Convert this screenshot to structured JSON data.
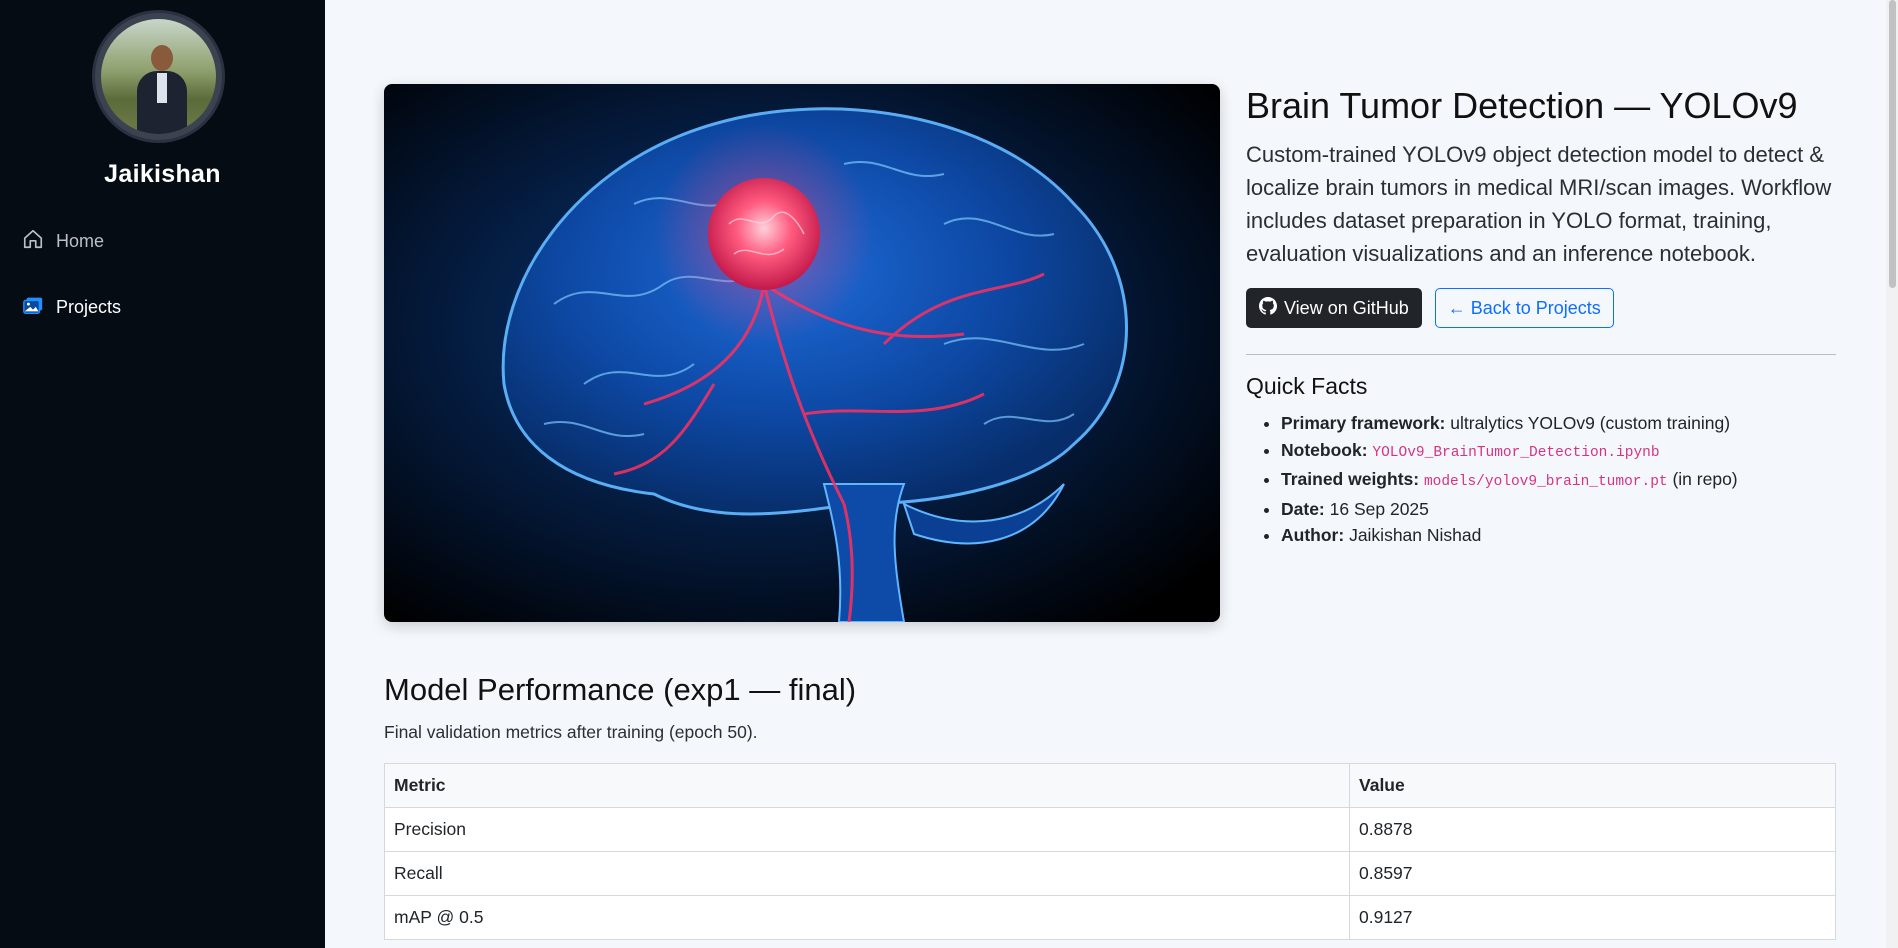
{
  "sidebar": {
    "name": "Jaikishan",
    "items": [
      {
        "label": "Home",
        "icon": "home-icon"
      },
      {
        "label": "Projects",
        "icon": "image-icon"
      }
    ]
  },
  "project": {
    "title": "Brain Tumor Detection — YOLOv9",
    "description": "Custom-trained YOLOv9 object detection model to detect & localize brain tumors in medical MRI/scan images. Workflow includes dataset preparation in YOLO format, training, evaluation visualizations and an inference notebook.",
    "github_button": "View on GitHub",
    "back_button": "← Back to Projects"
  },
  "quick_facts": {
    "title": "Quick Facts",
    "items": [
      {
        "label": "Primary framework:",
        "value": "ultralytics YOLOv9 (custom training)"
      },
      {
        "label": "Notebook:",
        "code": "YOLOv9_BrainTumor_Detection.ipynb"
      },
      {
        "label": "Trained weights:",
        "code": "models/yolov9_brain_tumor.pt",
        "suffix": "(in repo)"
      },
      {
        "label": "Date:",
        "value": "16 Sep 2025"
      },
      {
        "label": "Author:",
        "value": "Jaikishan Nishad"
      }
    ]
  },
  "performance": {
    "title": "Model Performance (exp1 — final)",
    "subtitle": "Final validation metrics after training (epoch 50).",
    "headers": [
      "Metric",
      "Value"
    ],
    "rows": [
      [
        "Precision",
        "0.8878"
      ],
      [
        "Recall",
        "0.8597"
      ],
      [
        "mAP @ 0.5",
        "0.9127"
      ]
    ]
  },
  "colors": {
    "sidebar_bg": "#060c14",
    "page_bg": "#f4f8fc",
    "accent": "#0d6efd",
    "code": "#d63384"
  }
}
